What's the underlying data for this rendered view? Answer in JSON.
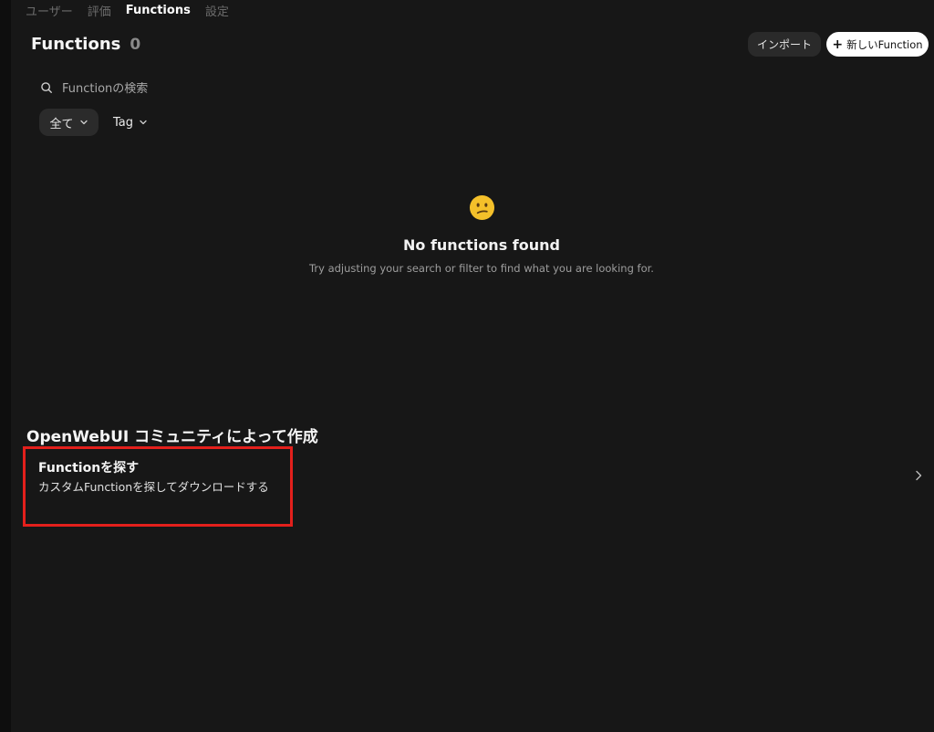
{
  "nav": {
    "tabs": [
      {
        "label": "ユーザー",
        "active": false
      },
      {
        "label": "評価",
        "active": false
      },
      {
        "label": "Functions",
        "active": true
      },
      {
        "label": "設定",
        "active": false
      }
    ]
  },
  "header": {
    "title": "Functions",
    "count": "0",
    "import_label": "インポート",
    "new_label": "新しいFunction",
    "new_icon": "plus-icon"
  },
  "search": {
    "placeholder": "Functionの検索",
    "value": "",
    "icon": "search-icon"
  },
  "filters": {
    "all_label": "全て",
    "tag_label": "Tag"
  },
  "empty_state": {
    "emoji": "confused-face-icon",
    "title": "No functions found",
    "subtitle": "Try adjusting your search or filter to find what you are looking for."
  },
  "community": {
    "heading": "OpenWebUI コミュニティによって作成",
    "card_title": "Functionを探す",
    "card_subtitle": "カスタムFunctionを探してダウンロードする",
    "chevron": "chevron-right-icon"
  },
  "colors": {
    "background": "#171717",
    "highlight": "#e3201c",
    "emoji": "#f4c02a"
  }
}
